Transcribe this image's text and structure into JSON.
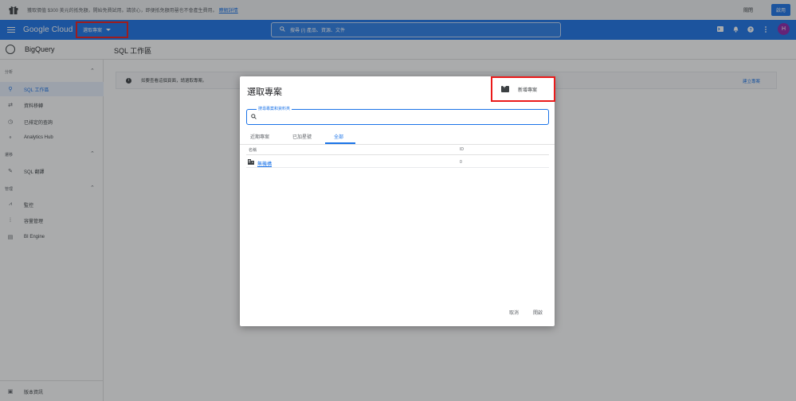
{
  "promo": {
    "text": "獲取價值 $300 美元的抵免額，開始免費試用。請放心，即便抵免額用罄也不會產生費用。",
    "link": "瞭解詳情",
    "dismiss": "關閉",
    "activate": "啟用"
  },
  "header": {
    "brand": "Google Cloud",
    "project_label": "選取專案",
    "search_placeholder": "搜尋 (/) 產品、資源、文件",
    "avatar_letter": "H"
  },
  "app": {
    "product": "BigQuery",
    "workspace_title": "SQL 工作區"
  },
  "sidebar": {
    "sections": [
      {
        "label": "分析"
      },
      {
        "label": "遷移"
      },
      {
        "label": "管理"
      }
    ],
    "items": [
      {
        "label": "SQL 工作區"
      },
      {
        "label": "資料移轉"
      },
      {
        "label": "已排定的查詢"
      },
      {
        "label": "Analytics Hub"
      },
      {
        "label": "SQL 翻譯"
      },
      {
        "label": "監控"
      },
      {
        "label": "容量管理"
      },
      {
        "label": "BI Engine"
      }
    ],
    "release_notes": "版本資訊"
  },
  "infobar": {
    "text": "如要查看這個頁面，請選取專案。",
    "action": "建立專案"
  },
  "dialog": {
    "title": "選取專案",
    "new_project": "新增專案",
    "search_label": "搜尋專案和資料夾",
    "tabs": [
      "近期專案",
      "已加星號",
      "全部"
    ],
    "columns": {
      "name": "名稱",
      "id": "ID"
    },
    "rows": [
      {
        "name": "無機構",
        "id": "0"
      }
    ],
    "cancel": "取消",
    "open": "開啟"
  }
}
